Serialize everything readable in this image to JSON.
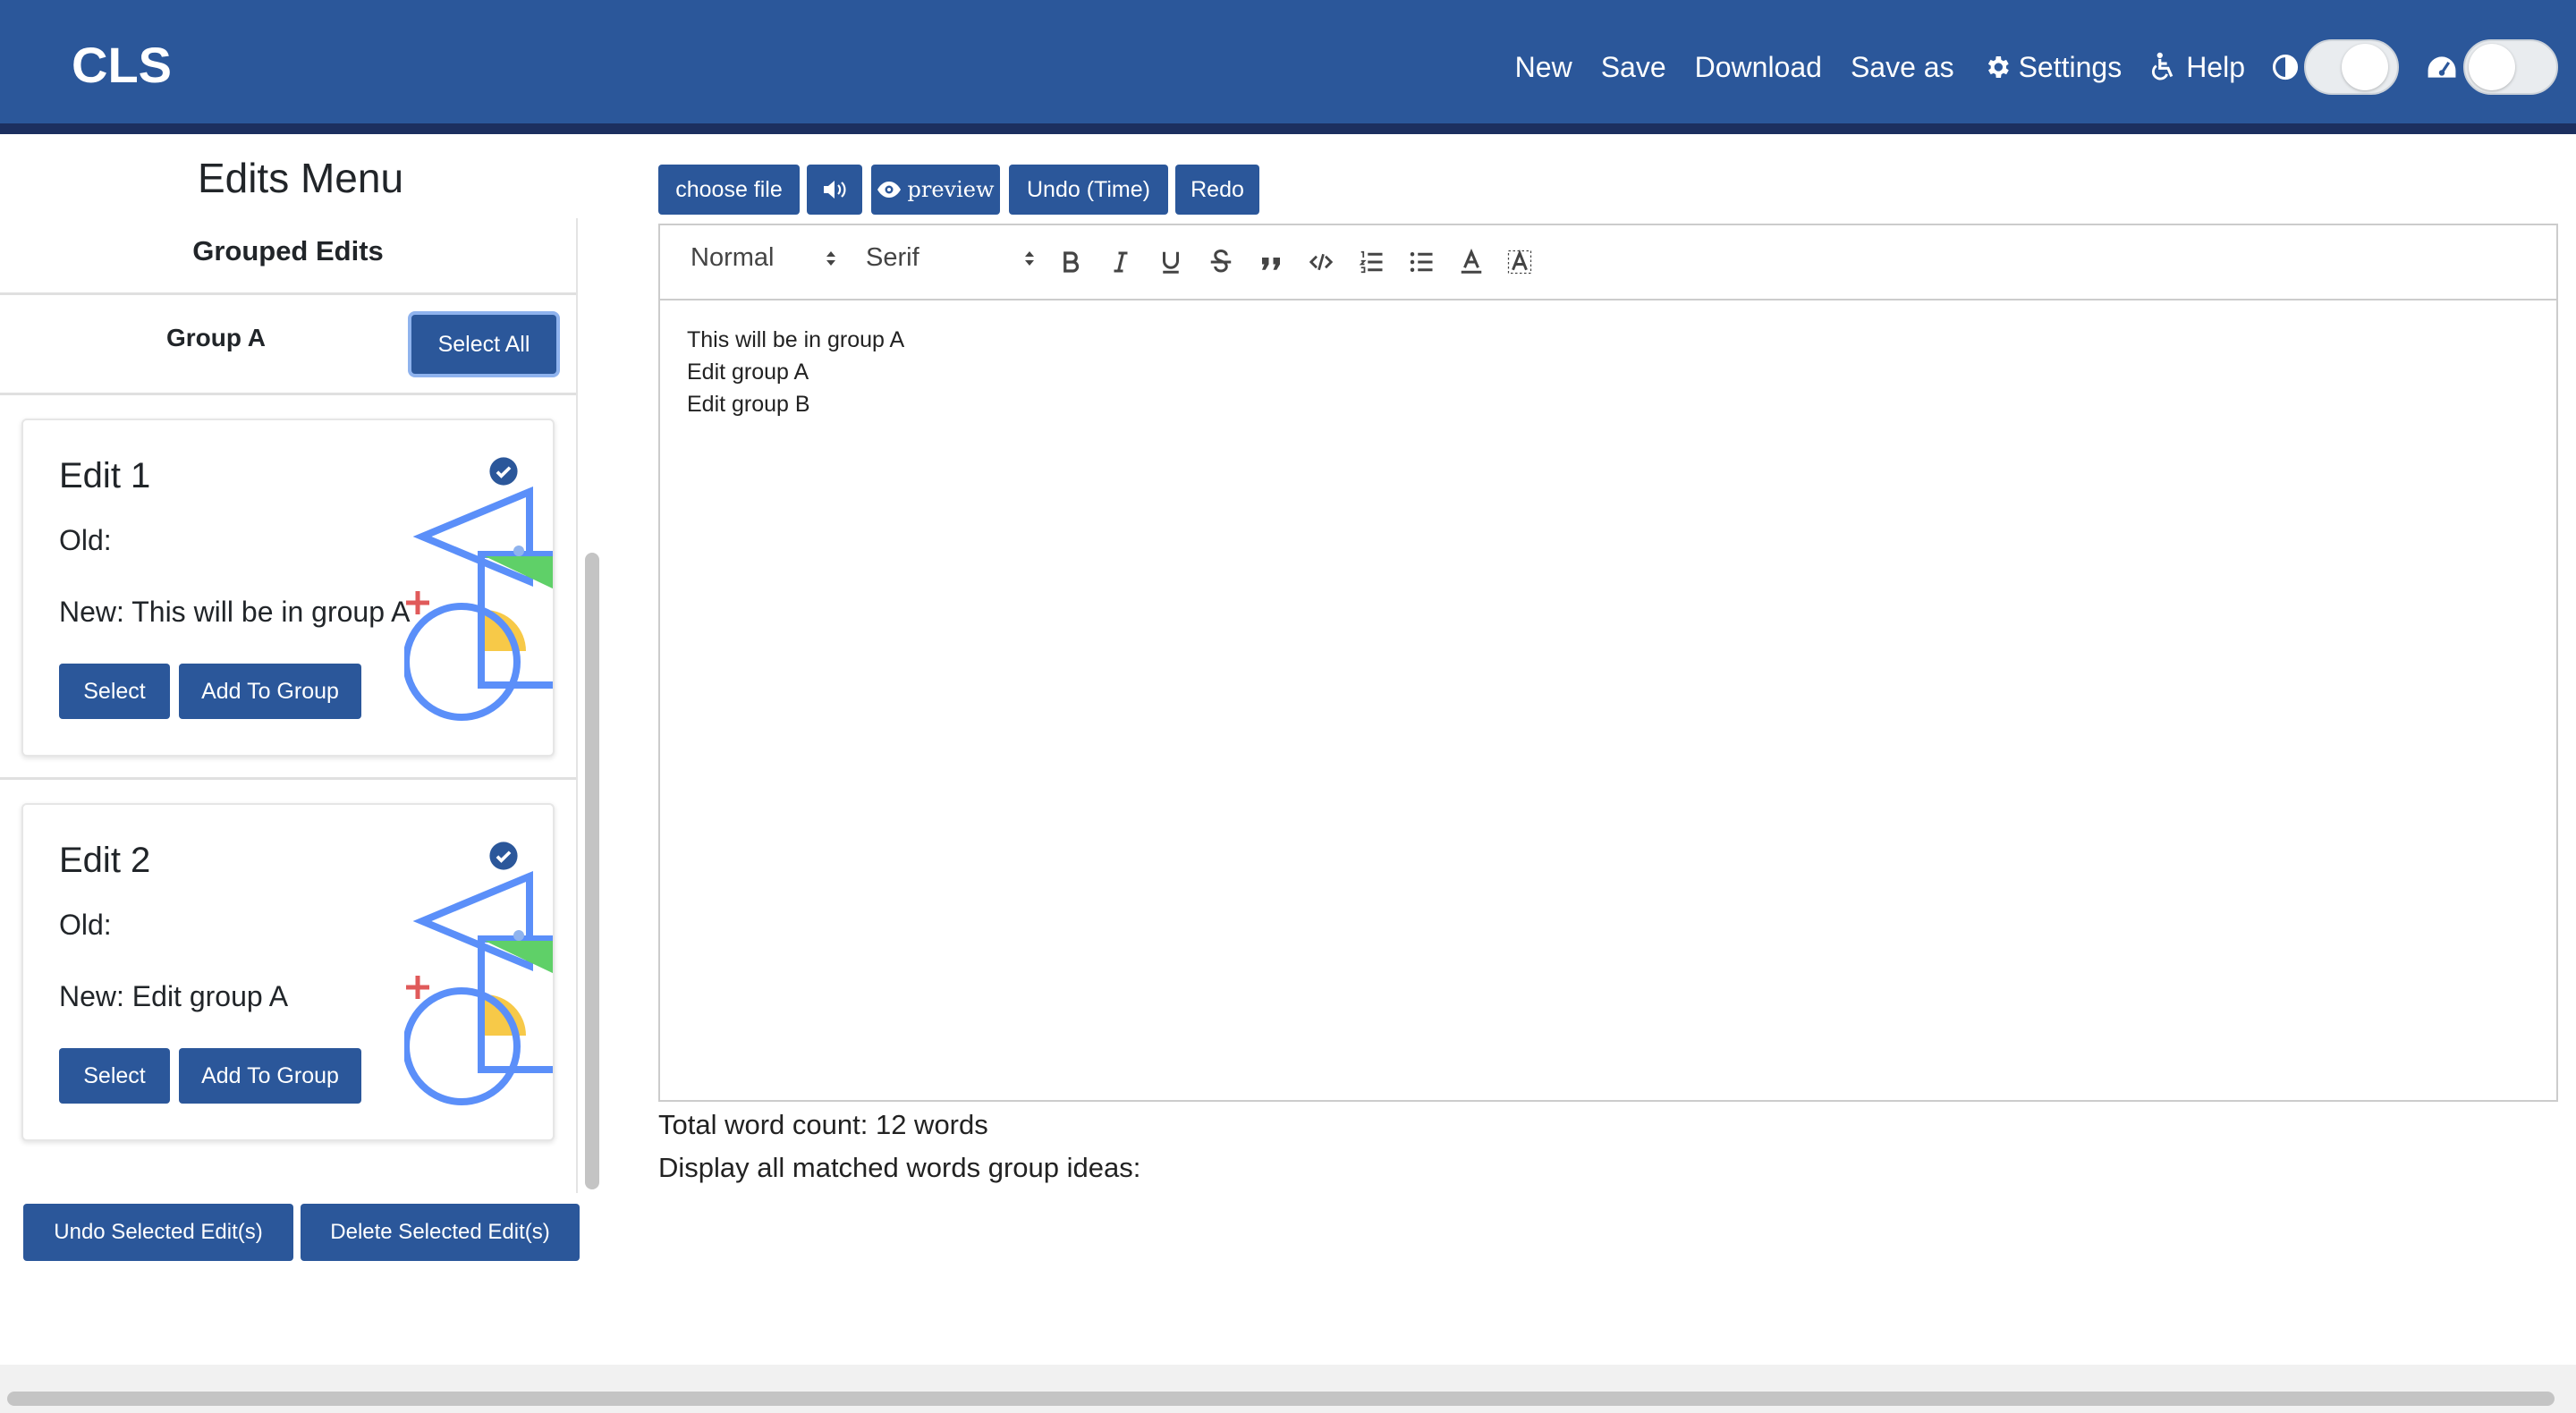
{
  "header": {
    "brand": "CLS",
    "nav": {
      "new": "New",
      "save": "Save",
      "download": "Download",
      "save_as": "Save as",
      "settings": "Settings",
      "help": "Help"
    }
  },
  "sidebar": {
    "title": "Edits Menu",
    "grouped_title": "Grouped Edits",
    "group": {
      "label": "Group A",
      "select_all": "Select All"
    },
    "cards": [
      {
        "title": "Edit 1",
        "old": "Old:",
        "new": "New: This will be in group A",
        "select": "Select",
        "add": "Add To Group"
      },
      {
        "title": "Edit 2",
        "old": "Old:",
        "new": "New: Edit group A",
        "select": "Select",
        "add": "Add To Group"
      }
    ],
    "undo_selected": "Undo Selected Edit(s)",
    "delete_selected": "Delete Selected Edit(s)"
  },
  "toolbar": {
    "choose_file": "choose file",
    "preview": "preview",
    "undo_time": "Undo (Time)",
    "redo": "Redo"
  },
  "editor": {
    "format_select": "Normal",
    "font_select": "Serif",
    "lines": [
      "This will be in group A",
      "Edit group A",
      "Edit group B"
    ]
  },
  "info": {
    "word_count": "Total word count: 12 words",
    "matched": "Display all matched words group ideas:"
  },
  "colors": {
    "primary": "#2b579a",
    "header_border": "#1c2f5f"
  }
}
